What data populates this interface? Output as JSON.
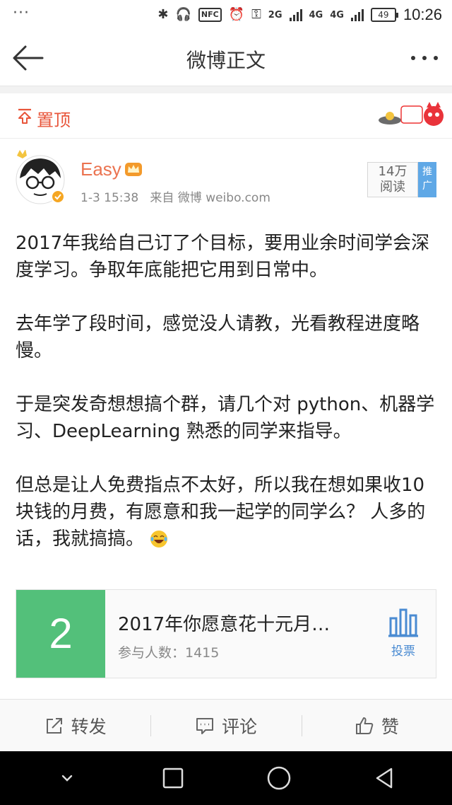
{
  "status_bar": {
    "menu_dots": "···",
    "nfc": "NFC",
    "network_1": "2G",
    "network_2": "4G",
    "network_3": "4G",
    "battery": "49",
    "time": "10:26"
  },
  "header": {
    "title": "微博正文"
  },
  "pinned": {
    "label": "置顶"
  },
  "post": {
    "author": "Easy",
    "time": "1-3 15:38",
    "source": "来自 微博 weibo.com",
    "read_count_number": "14万",
    "read_count_label": "阅读",
    "promo_label": "推广",
    "paragraphs": [
      "2017年我给自己订了个目标，要用业余时间学会深度学习。争取年底能把它用到日常中。",
      "去年学了段时间，感觉没人请教，光看教程进度略慢。",
      "于是突发奇想想搞个群，请几个对 python、机器学习、DeepLearning 熟悉的同学来指导。",
      "但总是让人免费指点不太好，所以我在想如果收10块钱的月费，有愿意和我一起学的同学么？ 人多的话，我就搞搞。"
    ]
  },
  "vote": {
    "number": "2",
    "title": "2017年你愿意花十元月…",
    "participants": "参与人数：1415",
    "button_label": "投票"
  },
  "actions": {
    "repost": "转发",
    "comment": "评论",
    "like": "赞"
  },
  "colors": {
    "accent_orange": "#eb7350",
    "vote_green": "#53c07a",
    "link_blue": "#4a8bd2"
  }
}
